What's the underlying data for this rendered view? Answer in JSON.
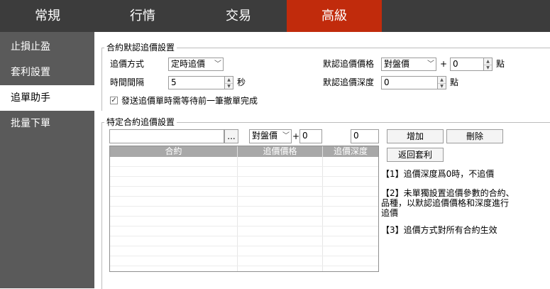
{
  "top_tabs": [
    {
      "label": "常規",
      "active": false
    },
    {
      "label": "行情",
      "active": false
    },
    {
      "label": "交易",
      "active": false
    },
    {
      "label": "高級",
      "active": true
    }
  ],
  "sidebar": {
    "items": [
      {
        "label": "止損止盈",
        "active": false
      },
      {
        "label": "套利設置",
        "active": false
      },
      {
        "label": "追單助手",
        "active": true
      },
      {
        "label": "批量下單",
        "active": false
      }
    ]
  },
  "default_settings": {
    "title": "合約默認追價設置",
    "chase_method_label": "追價方式",
    "chase_method_value": "定時追價",
    "interval_label": "時間間隔",
    "interval_value": "5",
    "interval_unit": "秒",
    "default_price_label": "默認追價價格",
    "default_price_value": "對盤價",
    "plus_sign": "+",
    "default_price_offset": "0",
    "tick_unit": "點",
    "default_depth_label": "默認追價深度",
    "default_depth_value": "0",
    "depth_unit": "點",
    "wait_cancel_checked": true,
    "wait_cancel_label": "發送追價單時需等待前一筆撤單完成"
  },
  "specific_settings": {
    "title": "特定合約追價設置",
    "contract_value": "",
    "browse_label": "...",
    "price_type_value": "對盤價",
    "plus_sign": "+",
    "offset_value": "0",
    "depth_value": "0",
    "add_label": "增加",
    "delete_label": "刪除",
    "back_label": "返回套利",
    "table_headers": [
      "合約",
      "追價價格",
      "追價深度"
    ],
    "notes": [
      "【1】追價深度爲0時，不追價",
      "【2】未單獨設置追價參數的合約、品種，以默認追價價格和深度進行追價",
      "【3】追價方式對所有合約生效"
    ]
  },
  "colors": {
    "topbar_bg": "#3c3c3c",
    "active_tab": "#c12b0c",
    "sidebar_bg": "#5a5a5a",
    "table_header_bg": "#a8a8a8"
  },
  "icons": {
    "dropdown": "chevron-down-icon",
    "spinner_up": "spinner-up-icon",
    "spinner_down": "spinner-down-icon",
    "checkbox": "checkmark-icon"
  }
}
